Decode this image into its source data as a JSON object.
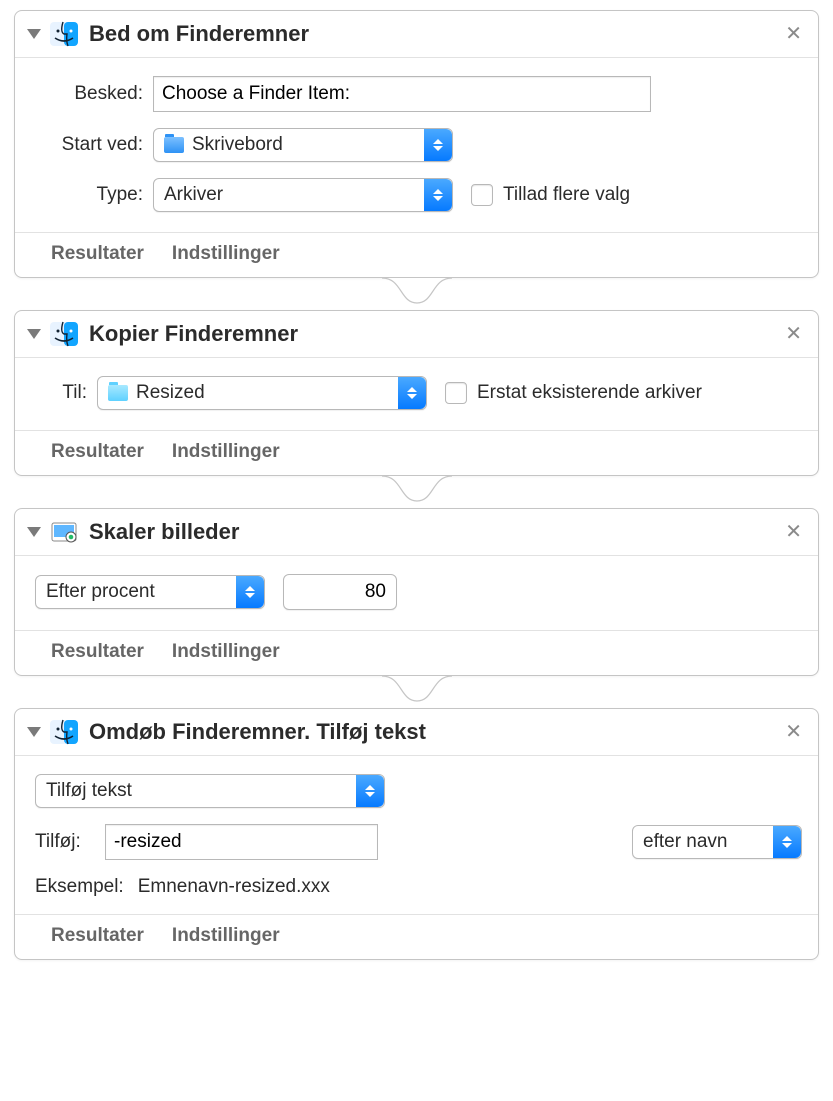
{
  "footer": {
    "results": "Resultater",
    "options": "Indstillinger"
  },
  "actions": [
    {
      "title": "Bed om Finderemner",
      "icon": "finder",
      "rows": {
        "message_label": "Besked:",
        "message_value": "Choose a Finder Item:",
        "start_label": "Start ved:",
        "start_value": "Skrivebord",
        "type_label": "Type:",
        "type_value": "Arkiver",
        "allow_multiple": "Tillad flere valg"
      }
    },
    {
      "title": "Kopier Finderemner",
      "icon": "finder",
      "rows": {
        "to_label": "Til:",
        "to_value": "Resized",
        "replace": "Erstat eksisterende arkiver"
      }
    },
    {
      "title": "Skaler billeder",
      "icon": "preview",
      "rows": {
        "mode_value": "Efter procent",
        "amount": "80"
      }
    },
    {
      "title": "Omdøb Finderemner. Tilføj tekst",
      "icon": "finder",
      "rows": {
        "op_value": "Tilføj tekst",
        "add_label": "Tilføj:",
        "add_value": "-resized",
        "position_value": "efter navn",
        "example_label": "Eksempel:",
        "example_value": "Emnenavn-resized.xxx"
      }
    }
  ]
}
